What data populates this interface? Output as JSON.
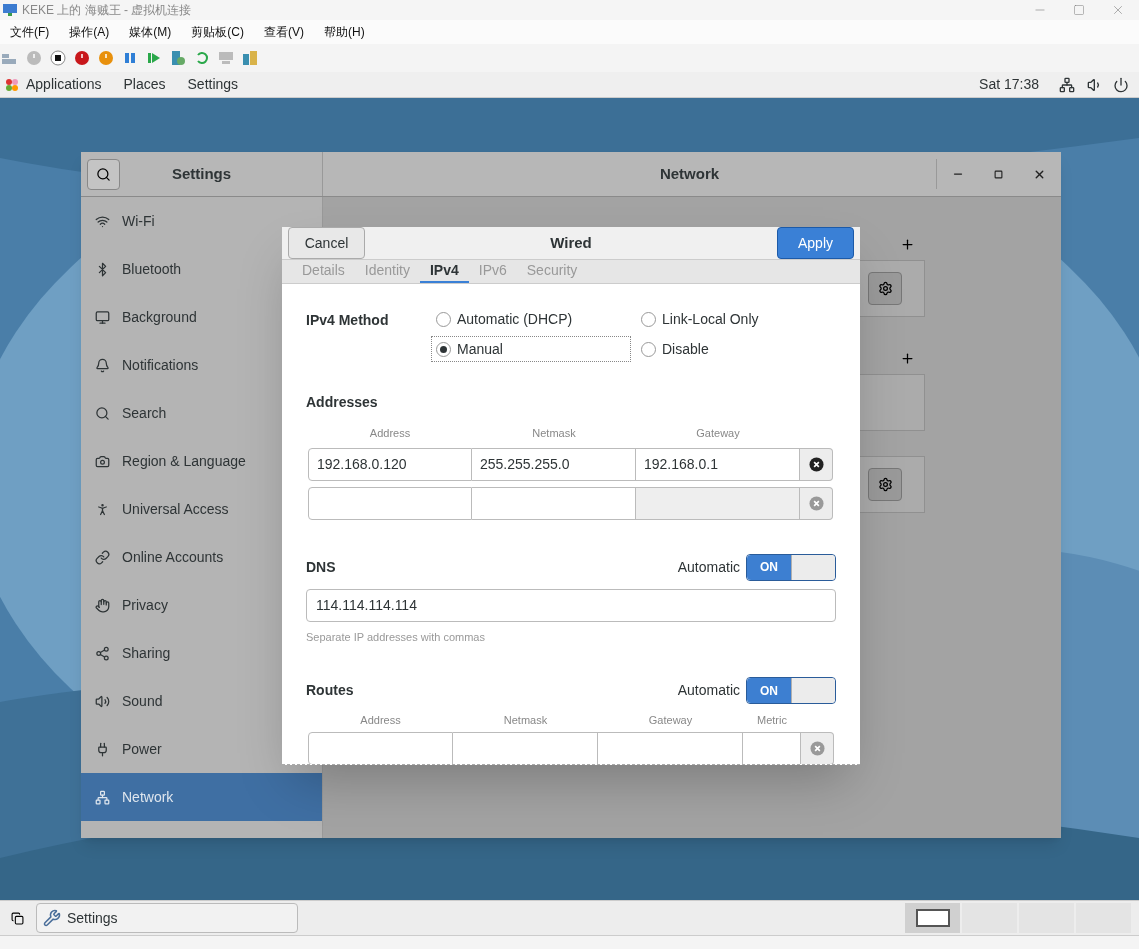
{
  "vm_window": {
    "title": "KEKE 上的 海贼王 - 虚拟机连接",
    "menu": [
      "文件(F)",
      "操作(A)",
      "媒体(M)",
      "剪贴板(C)",
      "查看(V)",
      "帮助(H)"
    ]
  },
  "top_bar": {
    "menus": [
      "Applications",
      "Places",
      "Settings"
    ],
    "clock": "Sat 17:38"
  },
  "settings_window": {
    "sidebar_title": "Settings",
    "panel_title": "Network",
    "sidebar": [
      {
        "label": "Wi-Fi",
        "selected": false
      },
      {
        "label": "Bluetooth",
        "selected": false
      },
      {
        "label": "Background",
        "selected": false
      },
      {
        "label": "Notifications",
        "selected": false
      },
      {
        "label": "Search",
        "selected": false
      },
      {
        "label": "Region & Language",
        "selected": false
      },
      {
        "label": "Universal Access",
        "selected": false
      },
      {
        "label": "Online Accounts",
        "selected": false
      },
      {
        "label": "Privacy",
        "selected": false
      },
      {
        "label": "Sharing",
        "selected": false
      },
      {
        "label": "Sound",
        "selected": false
      },
      {
        "label": "Power",
        "selected": false
      },
      {
        "label": "Network",
        "selected": true
      }
    ]
  },
  "dialog": {
    "title": "Wired",
    "cancel": "Cancel",
    "apply": "Apply",
    "tabs": [
      {
        "label": "Details",
        "selected": false
      },
      {
        "label": "Identity",
        "selected": false
      },
      {
        "label": "IPv4",
        "selected": true
      },
      {
        "label": "IPv6",
        "selected": false
      },
      {
        "label": "Security",
        "selected": false
      }
    ],
    "method": {
      "label": "IPv4 Method",
      "options": [
        {
          "label": "Automatic (DHCP)",
          "selected": false
        },
        {
          "label": "Link-Local Only",
          "selected": false
        },
        {
          "label": "Manual",
          "selected": true
        },
        {
          "label": "Disable",
          "selected": false
        }
      ]
    },
    "addresses": {
      "title": "Addresses",
      "columns": [
        "Address",
        "Netmask",
        "Gateway"
      ],
      "rows": [
        {
          "address": "192.168.0.120",
          "netmask": "255.255.255.0",
          "gateway": "192.168.0.1",
          "empty": false
        },
        {
          "empty": true
        }
      ]
    },
    "dns": {
      "title": "DNS",
      "automatic_label": "Automatic",
      "automatic": true,
      "on_text": "ON",
      "value": "114.114.114.114",
      "hint": "Separate IP addresses with commas"
    },
    "routes": {
      "title": "Routes",
      "automatic_label": "Automatic",
      "automatic": true,
      "on_text": "ON",
      "columns": [
        "Address",
        "Netmask",
        "Gateway",
        "Metric"
      ]
    }
  },
  "taskbar": {
    "window_button": "Settings",
    "workspaces": [
      {
        "selected": true
      },
      {
        "selected": false
      },
      {
        "selected": false
      },
      {
        "selected": false
      }
    ]
  }
}
